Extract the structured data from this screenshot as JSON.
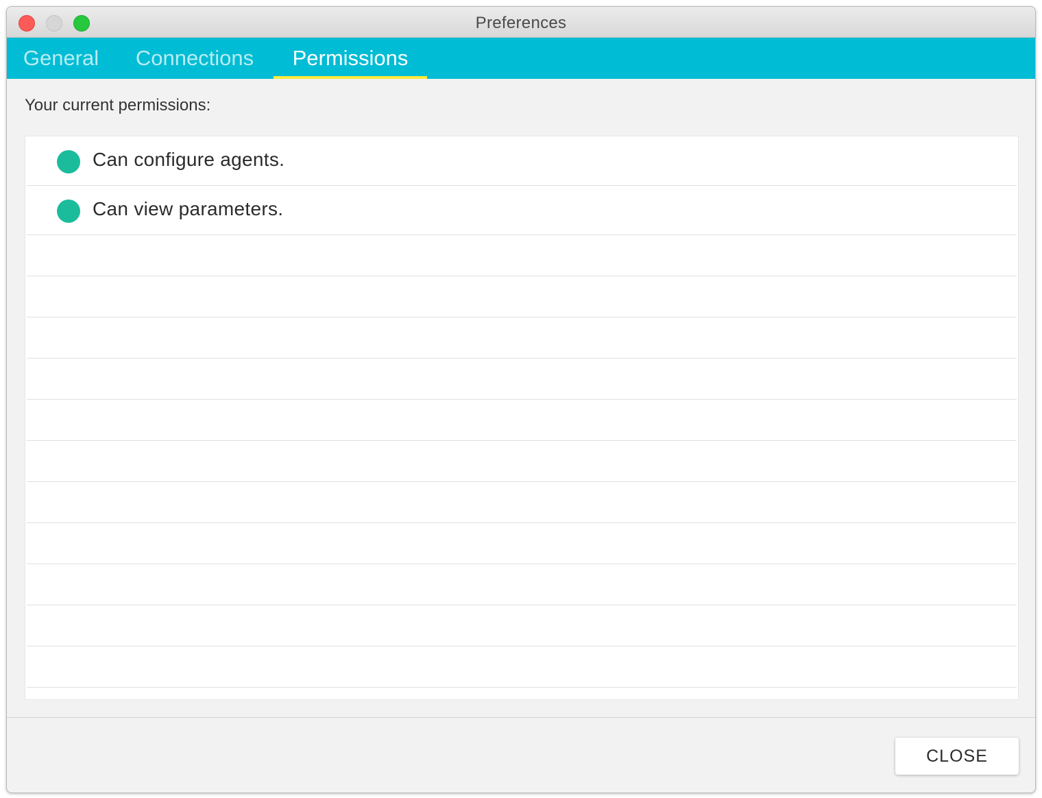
{
  "window": {
    "title": "Preferences"
  },
  "tabs": [
    {
      "label": "General",
      "active": false
    },
    {
      "label": "Connections",
      "active": false
    },
    {
      "label": "Permissions",
      "active": true
    }
  ],
  "permissions": {
    "intro": "Your current permissions:",
    "items": [
      {
        "label": "Can configure agents.",
        "status_color": "#1abc9c"
      },
      {
        "label": "Can view parameters.",
        "status_color": "#1abc9c"
      }
    ]
  },
  "footer": {
    "close_label": "CLOSE"
  },
  "colors": {
    "accent": "#00bcd4",
    "tab_indicator": "#ffeb3b",
    "status_granted": "#1abc9c"
  }
}
